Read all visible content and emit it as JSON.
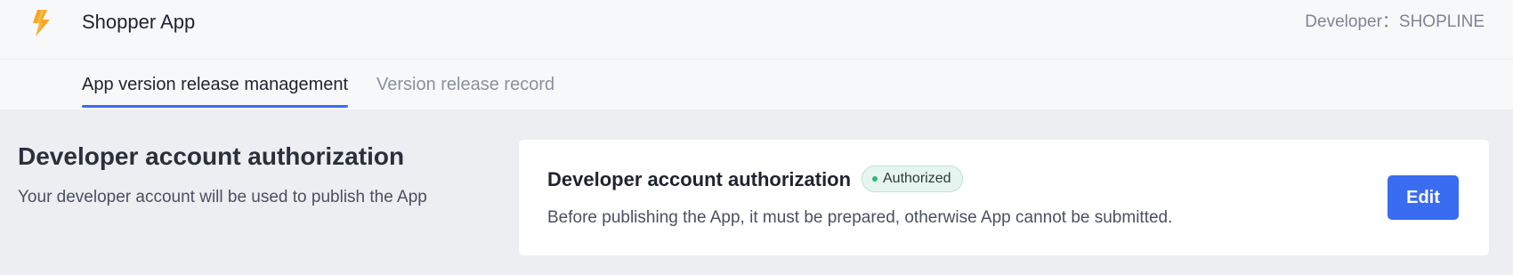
{
  "header": {
    "app_name": "Shopper App",
    "developer": "Developer：SHOPLINE",
    "logo_icon": "lightning-bolt-icon",
    "logo_color": "#f5a623"
  },
  "tabs": [
    {
      "label": "App version release management",
      "active": true
    },
    {
      "label": "Version release record",
      "active": false
    }
  ],
  "section": {
    "title": "Developer account authorization",
    "description": "Your developer account will be used to publish the App"
  },
  "card": {
    "title": "Developer account authorization",
    "status_badge": "Authorized",
    "description": "Before publishing the App, it must be prepared, otherwise App cannot be submitted.",
    "edit_label": "Edit"
  },
  "colors": {
    "accent": "#3a6cf2",
    "badge_bg": "#e6f5ef",
    "badge_dot": "#2fb876"
  }
}
